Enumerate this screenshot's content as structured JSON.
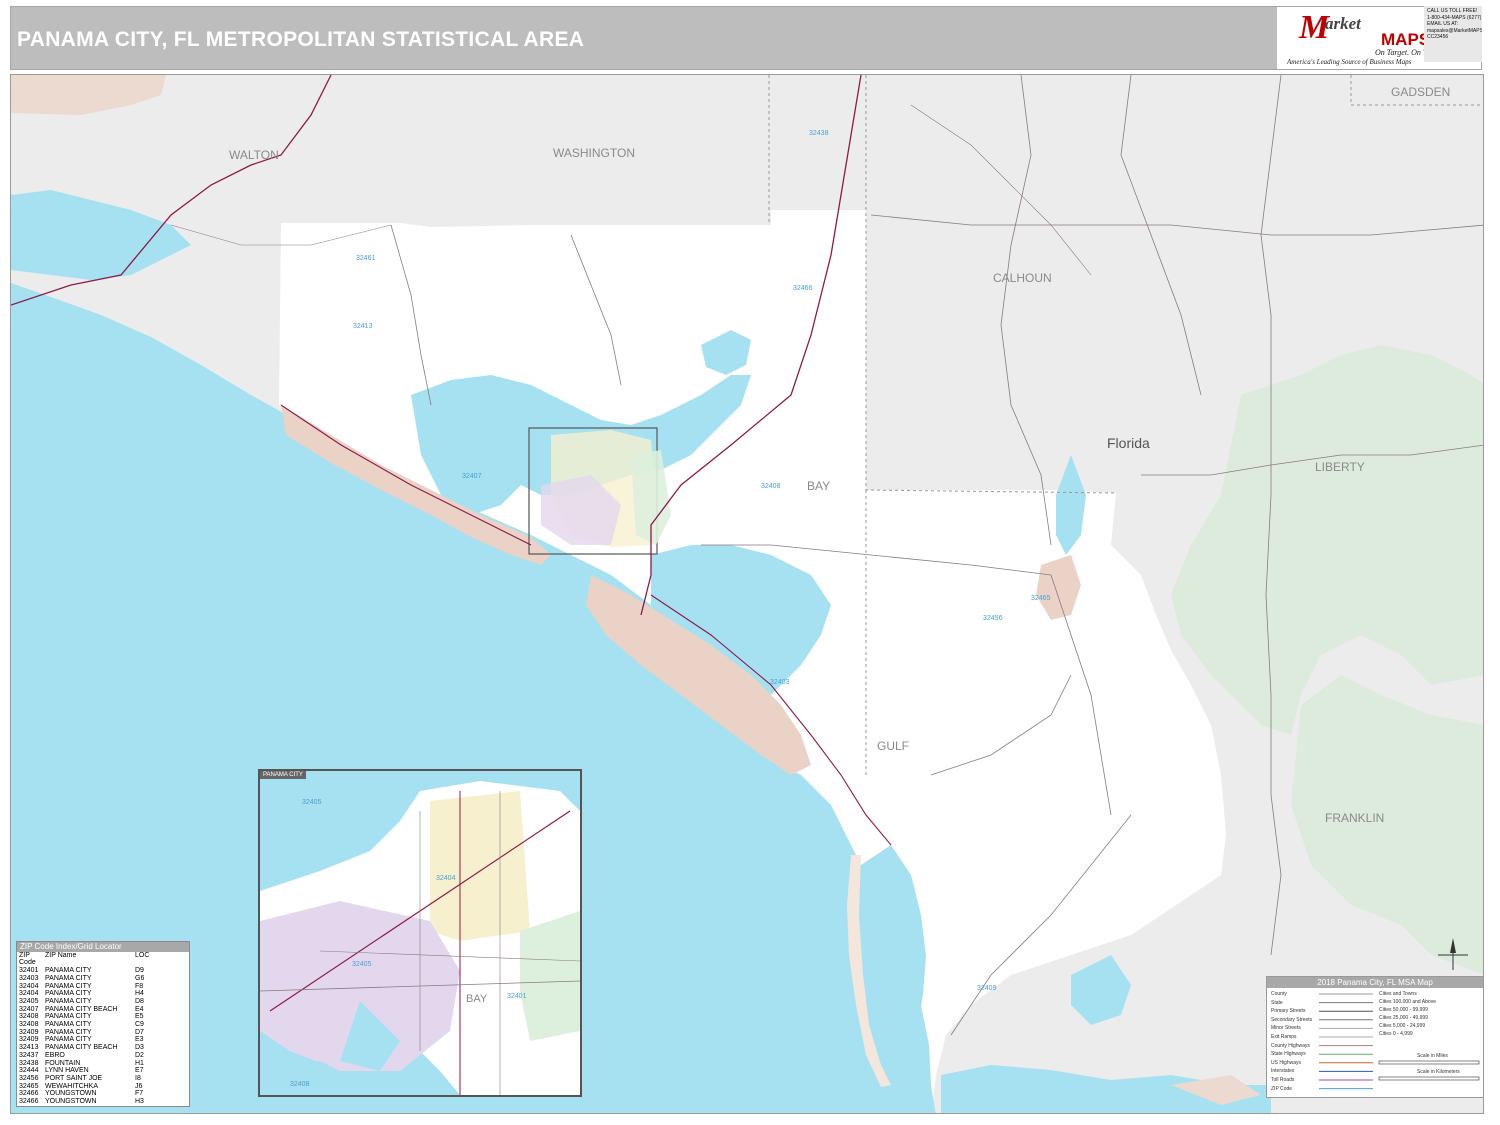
{
  "header": {
    "title": "PANAMA CITY, FL METROPOLITAN STATISTICAL AREA",
    "logo": {
      "initial": "M",
      "market": "arket",
      "maps": "MAPS",
      "tagline": "On Target. On Time.",
      "source": "America's Leading Source of Business Maps"
    },
    "contact": [
      "CALL US TOLL FREE!",
      "1-800-434-MAPS (6277)",
      "EMAIL US AT:",
      "mapsales@MarketMAPS.com",
      "CC23456"
    ]
  },
  "map": {
    "counties": [
      {
        "key": "walton",
        "name": "WALTON"
      },
      {
        "key": "washington",
        "name": "WASHINGTON"
      },
      {
        "key": "calhoun",
        "name": "CALHOUN"
      },
      {
        "key": "gadsden",
        "name": "GADSDEN"
      },
      {
        "key": "bay",
        "name": "BAY"
      },
      {
        "key": "liberty",
        "name": "LIBERTY"
      },
      {
        "key": "gulf",
        "name": "GULF"
      },
      {
        "key": "franklin",
        "name": "FRANKLIN"
      }
    ],
    "state_label": "Florida",
    "zip_labels": [
      "32413",
      "32461",
      "32438",
      "32466",
      "32407",
      "32408",
      "32456",
      "32465",
      "32403",
      "32409"
    ],
    "colors": {
      "water": "#a6e1f1",
      "outside_msa": "#ececec",
      "msa_land": "#ffffff",
      "forest": "#dcebdc",
      "roads": "#8a7a80",
      "highway": "#8b1a4a",
      "zip_pink": "#ead2c6",
      "zip_purple": "#e3d7ee",
      "zip_yellow": "#f6f0cf",
      "zip_green": "#ddf0dd"
    }
  },
  "inset": {
    "title": "PANAMA CITY",
    "labels": {
      "bay": "BAY",
      "zip_a": "32405",
      "zip_b": "32404",
      "zip_c": "32401",
      "zip_d": "32405",
      "zip_e": "32408"
    }
  },
  "zip_index": {
    "title": "ZIP Code Index/Grid Locator",
    "headers": {
      "code": "ZIP Code",
      "name": "ZIP Name",
      "loc": "LOC"
    },
    "rows": [
      {
        "code": "32401",
        "name": "PANAMA CITY",
        "loc": "D9"
      },
      {
        "code": "32403",
        "name": "PANAMA CITY",
        "loc": "G6"
      },
      {
        "code": "32404",
        "name": "PANAMA CITY",
        "loc": "F8"
      },
      {
        "code": "32404",
        "name": "PANAMA CITY",
        "loc": "H4"
      },
      {
        "code": "32405",
        "name": "PANAMA CITY",
        "loc": "D8"
      },
      {
        "code": "32407",
        "name": "PANAMA CITY BEACH",
        "loc": "E4"
      },
      {
        "code": "32408",
        "name": "PANAMA CITY",
        "loc": "E5"
      },
      {
        "code": "32408",
        "name": "PANAMA CITY",
        "loc": "C9"
      },
      {
        "code": "32409",
        "name": "PANAMA CITY",
        "loc": "D7"
      },
      {
        "code": "32409",
        "name": "PANAMA CITY",
        "loc": "E3"
      },
      {
        "code": "32413",
        "name": "PANAMA CITY BEACH",
        "loc": "D3"
      },
      {
        "code": "32437",
        "name": "EBRO",
        "loc": "D2"
      },
      {
        "code": "32438",
        "name": "FOUNTAIN",
        "loc": "H1"
      },
      {
        "code": "32444",
        "name": "LYNN HAVEN",
        "loc": "E7"
      },
      {
        "code": "32456",
        "name": "PORT SAINT JOE",
        "loc": "I8"
      },
      {
        "code": "32465",
        "name": "WEWAHITCHKA",
        "loc": "J6"
      },
      {
        "code": "32466",
        "name": "YOUNGSTOWN",
        "loc": "F7"
      },
      {
        "code": "32466",
        "name": "YOUNGSTOWN",
        "loc": "H3"
      }
    ]
  },
  "legend": {
    "title": "2018 Panama City, FL MSA Map",
    "items": [
      "County",
      "State",
      "Primary Streets",
      "Secondary Streets",
      "Minor Streets",
      "Exit Ramps",
      "County Highways",
      "State Highways",
      "US Highways",
      "Interstates",
      "Toll Roads",
      "ZIP Code"
    ],
    "cities_header": "Cities and Towns",
    "cities": [
      "Cities 100,000 and Above",
      "Cities 50,000 - 99,999",
      "Cities 25,000 - 49,999",
      "Cities 5,000 - 24,999",
      "Cities 0 - 4,999"
    ],
    "scale_miles": "Scale in Miles",
    "scale_km": "Scale in Kilometers"
  }
}
